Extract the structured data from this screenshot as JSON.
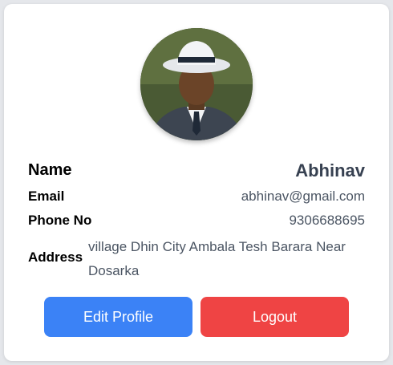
{
  "profile": {
    "name_label": "Name",
    "name_value": "Abhinav",
    "email_label": "Email",
    "email_value": "abhinav@gmail.com",
    "phone_label": "Phone No",
    "phone_value": "9306688695",
    "address_label": "Address",
    "address_value": "village Dhin City Ambala Tesh Barara Near Dosarka"
  },
  "actions": {
    "edit_label": "Edit Profile",
    "logout_label": "Logout"
  },
  "colors": {
    "edit_button": "#3b82f6",
    "logout_button": "#ef4444"
  }
}
